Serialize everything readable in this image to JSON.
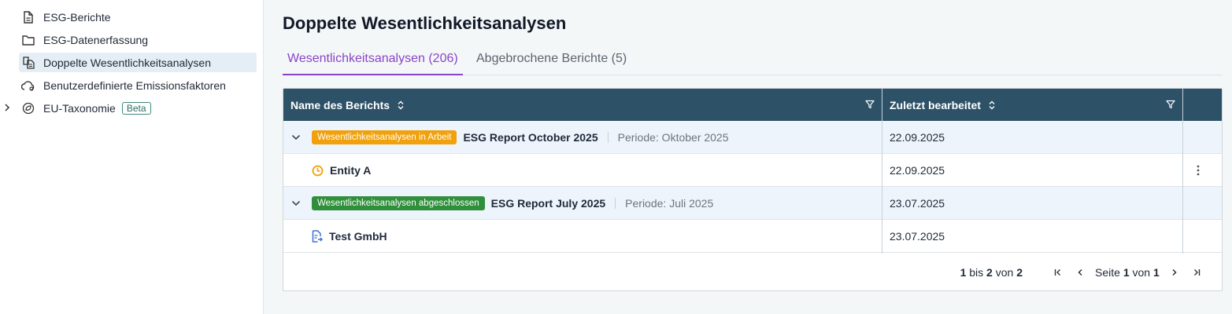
{
  "sidebar": {
    "items": [
      {
        "label": "ESG-Berichte",
        "icon": "document-icon"
      },
      {
        "label": "ESG-Datenerfassung",
        "icon": "folder-icon"
      },
      {
        "label": "Doppelte Wesentlichkeitsanalysen",
        "icon": "copy-documents-icon"
      },
      {
        "label": "Benutzerdefinierte Emissionsfaktoren",
        "icon": "cloud-settings-icon"
      },
      {
        "label": "EU-Taxonomie",
        "icon": "leaf-circle-icon",
        "badge": "Beta"
      }
    ]
  },
  "page": {
    "title": "Doppelte Wesentlichkeitsanalysen"
  },
  "tabs": [
    {
      "label": "Wesentlichkeitsanalysen (206)",
      "active": true
    },
    {
      "label": "Abgebrochene Berichte (5)",
      "active": false
    }
  ],
  "table": {
    "headers": {
      "name": "Name des Berichts",
      "edited": "Zuletzt bearbeitet"
    },
    "groups": [
      {
        "status": "Wesentlichkeitsanalysen in Arbeit",
        "status_color": "#f0a10c",
        "report": "ESG Report October 2025",
        "period": "Periode: Oktober 2025",
        "date": "22.09.2025",
        "child": {
          "name": "Entity A",
          "date": "22.09.2025",
          "icon": "clock-icon"
        }
      },
      {
        "status": "Wesentlichkeitsanalysen abgeschlossen",
        "status_color": "#2f8f3a",
        "report": "ESG Report July 2025",
        "period": "Periode: Juli 2025",
        "date": "23.07.2025",
        "child": {
          "name": "Test GmbH",
          "date": "23.07.2025",
          "icon": "document-export-icon"
        }
      }
    ]
  },
  "pagination": {
    "from": "1",
    "to_label": "bis",
    "to": "2",
    "of_label": "von",
    "total": "2",
    "page_label": "Seite",
    "page": "1",
    "page_of_label": "von",
    "pages": "1"
  },
  "colors": {
    "accent": "#8a44c8",
    "header_bg": "#2d5167"
  }
}
